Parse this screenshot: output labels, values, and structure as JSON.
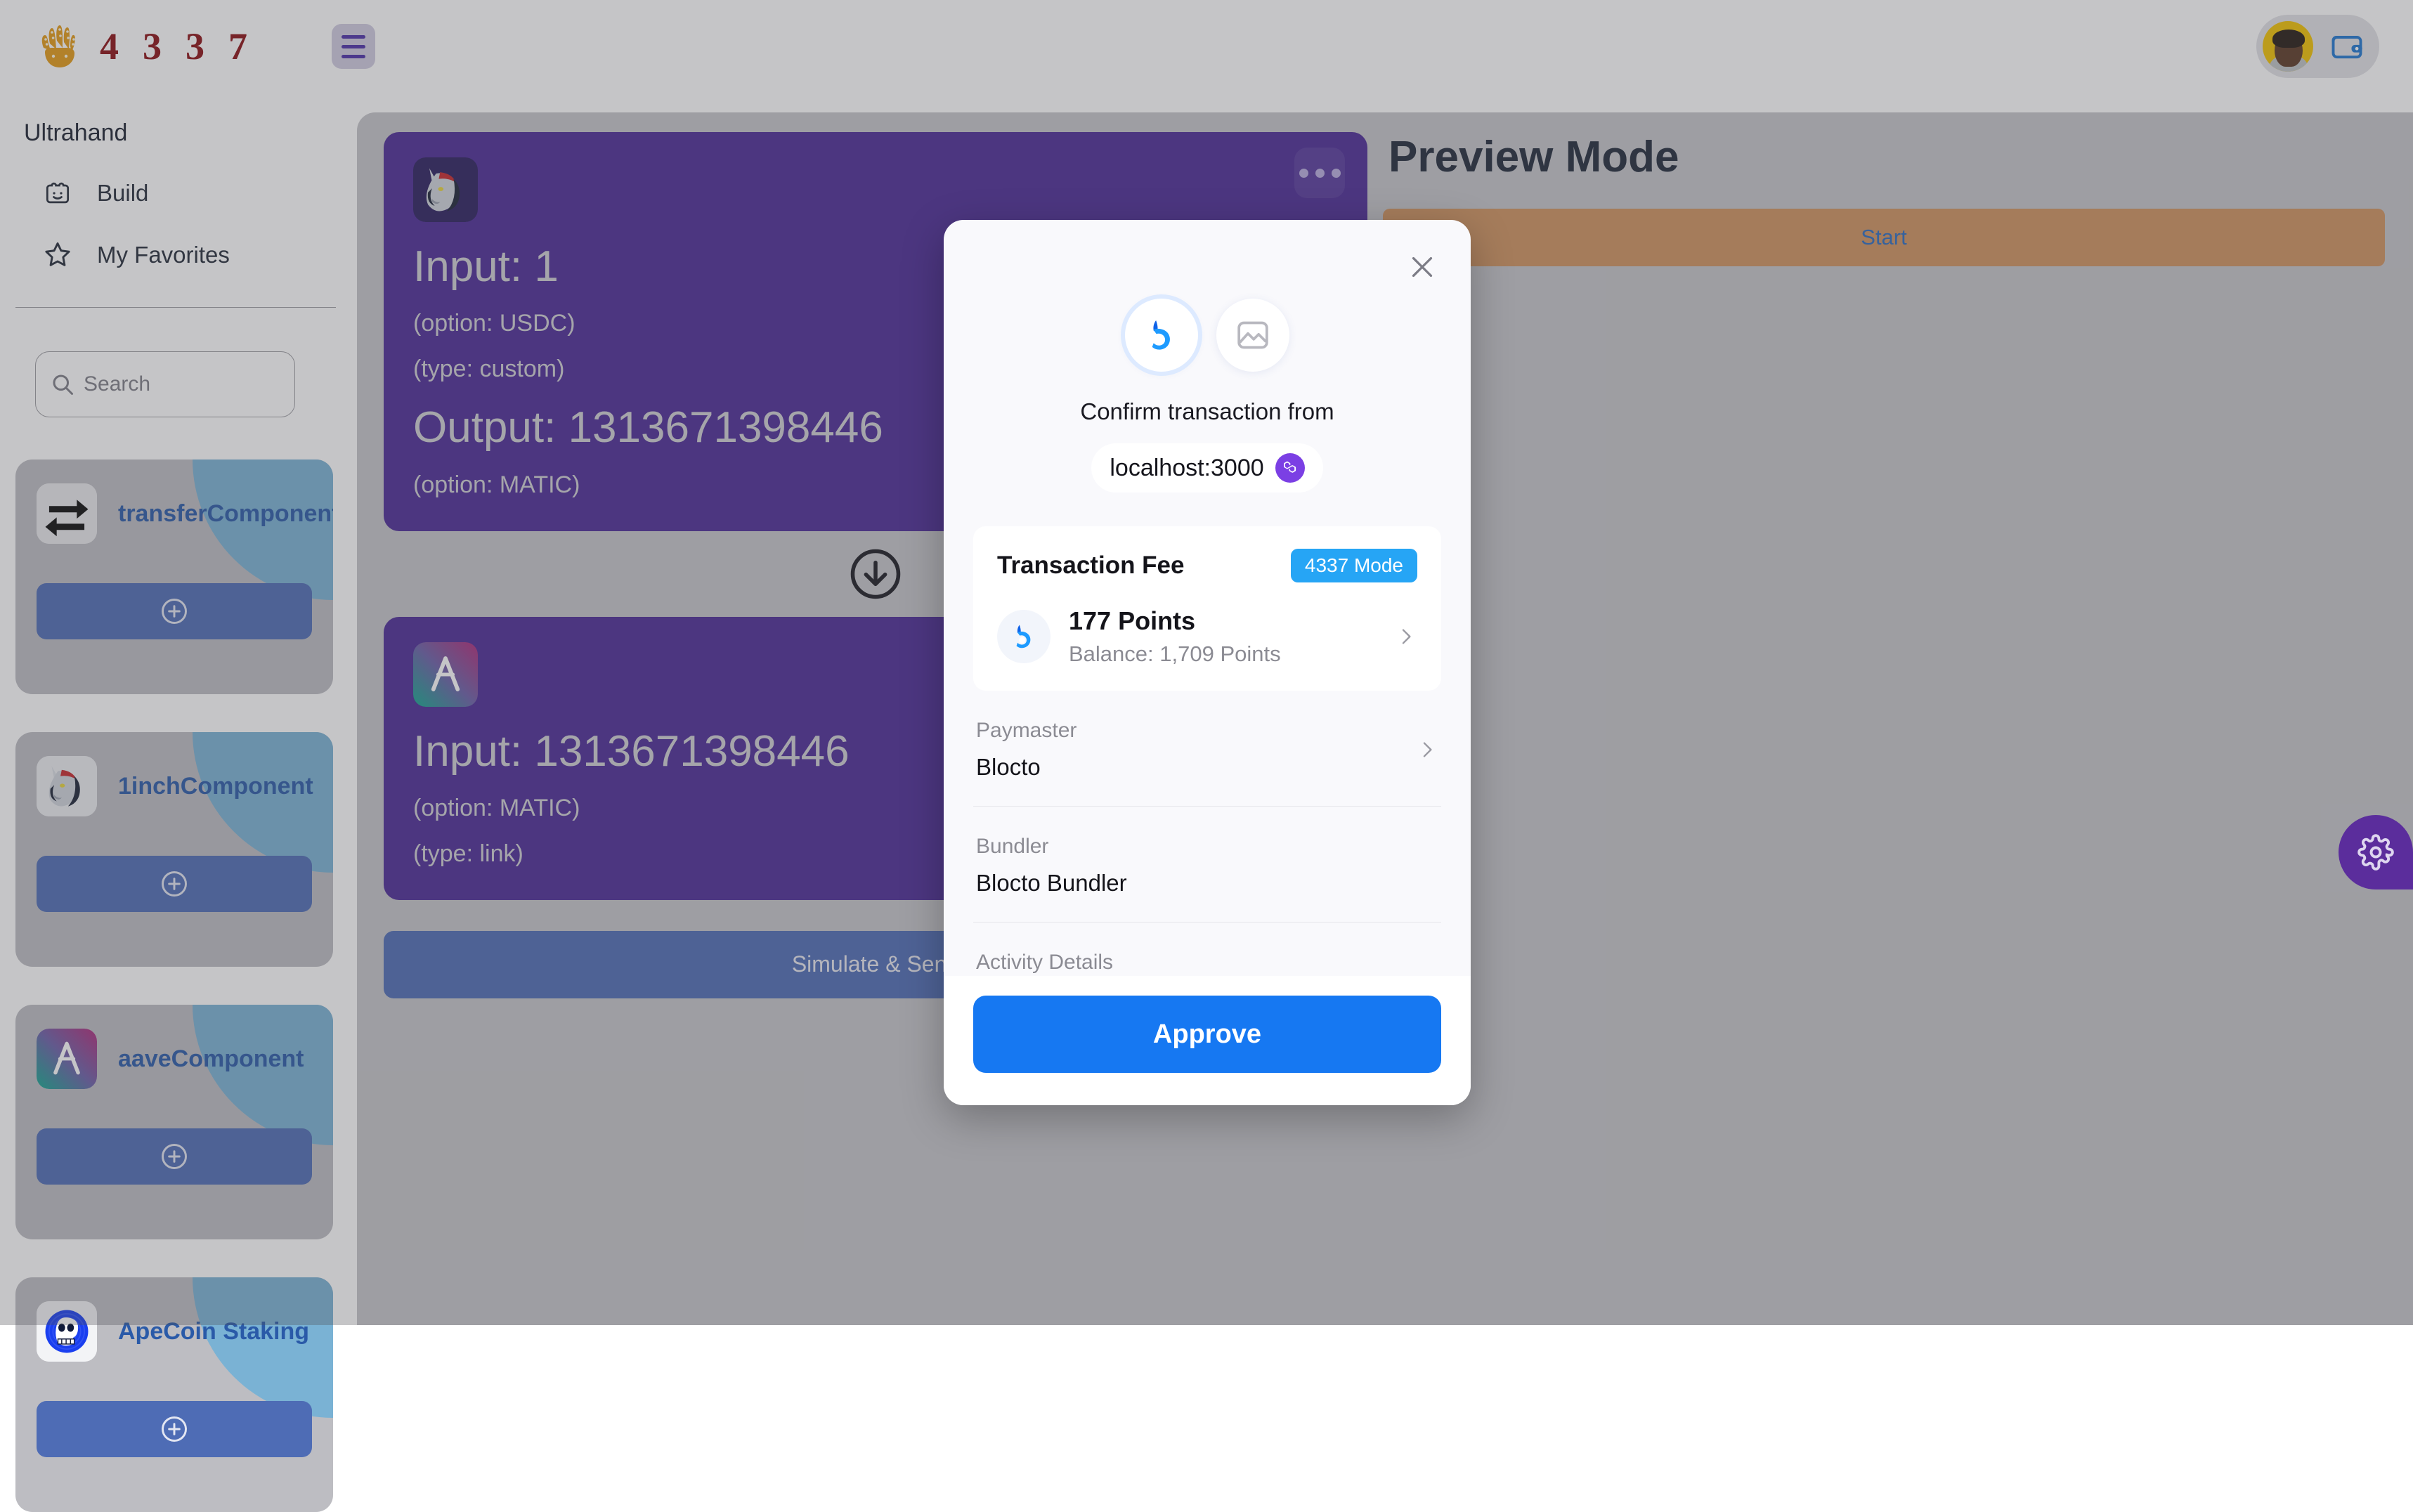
{
  "brand": {
    "hand_icon": "hand-logo-icon",
    "digits": [
      "4",
      "3",
      "3",
      "7"
    ],
    "menu_icon": "hamburger-menu-icon"
  },
  "topbar": {
    "avatar_alt": "user-avatar",
    "wallet_icon": "wallet-icon"
  },
  "sidebar": {
    "title": "Ultrahand",
    "nav": [
      {
        "label": "Build",
        "icon": "lego-face-icon"
      },
      {
        "label": "My Favorites",
        "icon": "star-icon"
      }
    ],
    "search": {
      "placeholder": "Search",
      "value": "",
      "icon": "search-icon",
      "filter_icon": "sliders-filter-icon"
    },
    "components": [
      {
        "name": "transferComponent",
        "icon": "transfer-arrows-icon",
        "add_label": "add-component"
      },
      {
        "name": "1inchComponent",
        "icon": "unicorn-1inch-icon",
        "add_label": "add-component"
      },
      {
        "name": "aaveComponent",
        "icon": "aave-ghost-icon",
        "add_label": "add-component"
      },
      {
        "name": "ApeCoin Staking",
        "icon": "apecoin-skull-icon",
        "add_label": "add-component"
      }
    ]
  },
  "canvas": {
    "nodes": [
      {
        "icon": "unicorn-1inch-icon",
        "input_label": "Input: 1",
        "lines": [
          "(option: USDC)",
          "(type: custom)"
        ],
        "output_label": "Output: 1313671398446",
        "output_lines": [
          "(option: MATIC)"
        ],
        "menu_icon": "more-dots-icon"
      },
      {
        "icon": "aave-ghost-icon",
        "input_label": "Input: 1313671398446",
        "lines": [
          "(option: MATIC)",
          "(type: link)"
        ],
        "output_label": "",
        "output_lines": []
      }
    ],
    "connector_icon": "arrow-down-circle-icon",
    "simulate_label": "Simulate & Send"
  },
  "preview": {
    "title": "Preview Mode",
    "start_label": "Start",
    "settings_icon": "gear-icon"
  },
  "modal": {
    "close_icon": "close-icon",
    "brand_icon": "blocto-logo-icon",
    "app_icon": "image-placeholder-icon",
    "confirm_text": "Confirm transaction from",
    "host": "localhost:3000",
    "chain_icon": "polygon-chain-icon",
    "fee": {
      "title": "Transaction Fee",
      "mode_badge": "4337 Mode",
      "coin_icon": "blocto-points-icon",
      "amount": "177 Points",
      "balance": "Balance: 1,709 Points",
      "chevron_icon": "chevron-right-icon"
    },
    "details": [
      {
        "label": "Paymaster",
        "value": "Blocto",
        "chevron_icon": "chevron-right-icon"
      },
      {
        "label": "Bundler",
        "value": "Blocto Bundler",
        "chevron_icon": ""
      },
      {
        "label": "Activity Details",
        "value": "",
        "chevron_icon": ""
      }
    ],
    "approve_label": "Approve"
  },
  "colors": {
    "brand_red": "#8b0f14",
    "brand_gold": "#e39a16",
    "node_purple": "#4b2a96",
    "accent_blue": "#1678f2",
    "mode_badge_blue": "#26a5f5",
    "start_orange": "#d0925e",
    "component_blue": "#2a5aa8",
    "corner_blue": "#7ab2d4"
  }
}
